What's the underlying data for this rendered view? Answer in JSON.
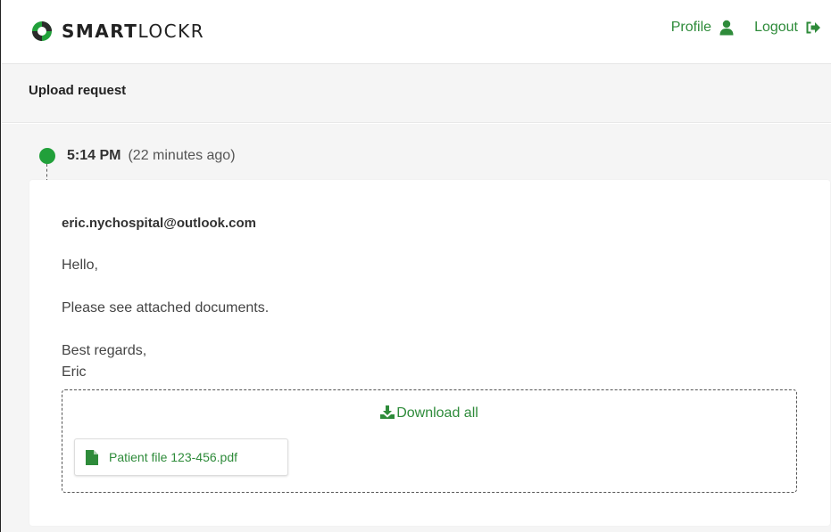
{
  "header": {
    "brand_bold": "SMART",
    "brand_light": "LOCKR",
    "profile_label": "Profile",
    "profile_icon": "user-icon",
    "logout_label": "Logout",
    "logout_icon": "sign-out-icon"
  },
  "subheader": {
    "title": "Upload request"
  },
  "timeline": {
    "time": "5:14 PM",
    "relative": "(22 minutes ago)"
  },
  "message": {
    "sender": "eric.nychospital@outlook.com",
    "lines": [
      "Hello,",
      "",
      "Please see attached documents.",
      "",
      "Best regards,",
      "Eric"
    ]
  },
  "attachments": {
    "download_all_label": "Download all",
    "download_icon": "download-icon",
    "files": [
      {
        "name": "Patient file 123-456.pdf",
        "icon": "file-icon"
      }
    ]
  },
  "colors": {
    "accent": "#2e8b3a",
    "dot": "#21a03a",
    "background": "#f5f5f5"
  }
}
